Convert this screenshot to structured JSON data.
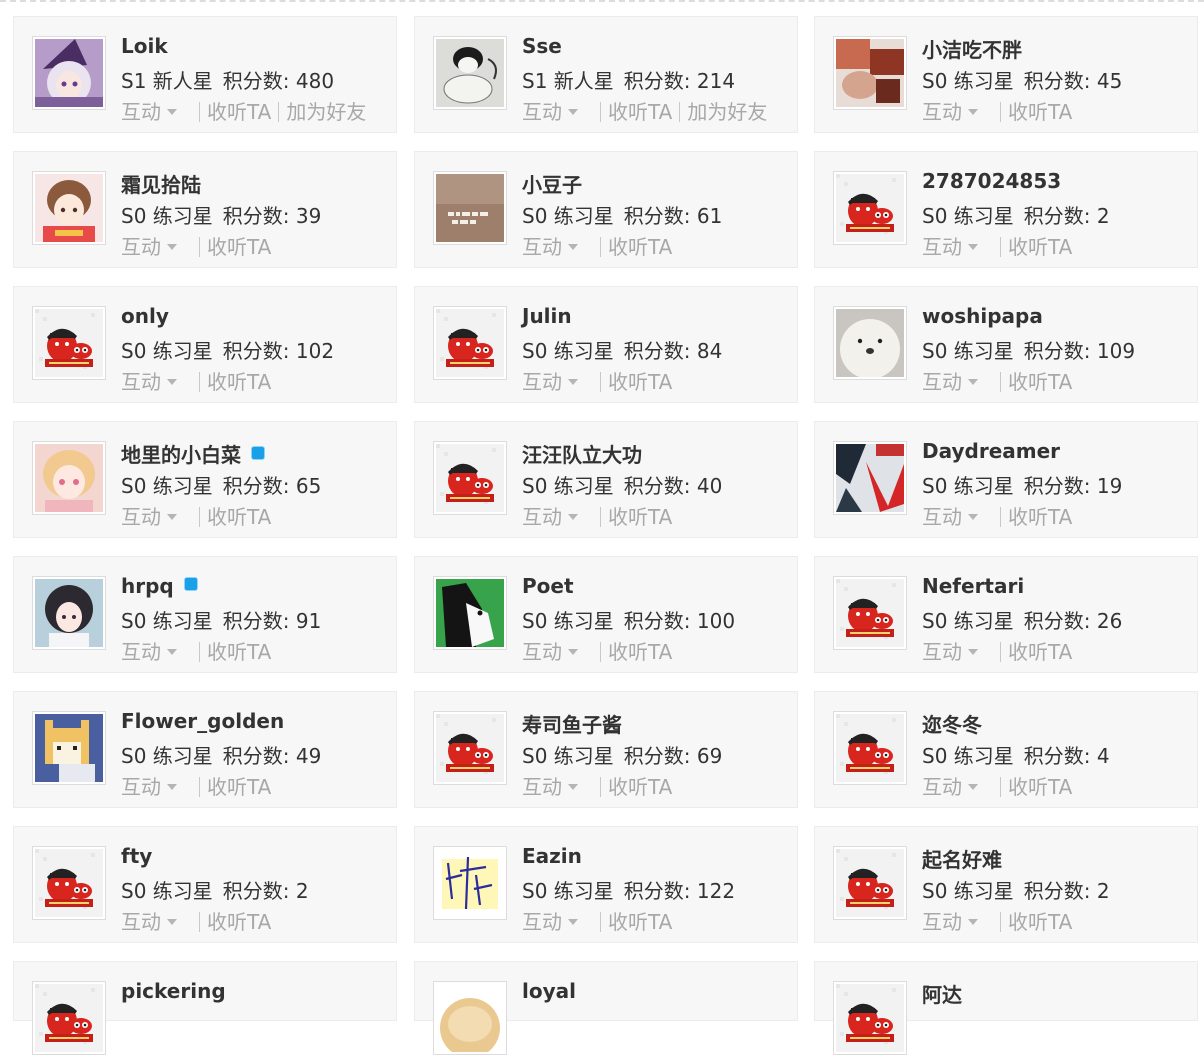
{
  "labels": {
    "interact": "互动",
    "follow": "收听TA",
    "add_friend": "加为好友",
    "score_prefix": "积分数: "
  },
  "users": [
    {
      "name": "Loik",
      "level": "S1 新人星",
      "score": "480",
      "avatar": "anime-witch",
      "badge": false,
      "add_friend": true
    },
    {
      "name": "Sse",
      "level": "S1 新人星",
      "score": "214",
      "avatar": "sketch-cat",
      "badge": false,
      "add_friend": true
    },
    {
      "name": "小洁吃不胖",
      "level": "S0 练习星",
      "score": "45",
      "avatar": "photo-warm",
      "badge": false,
      "add_friend": false
    },
    {
      "name": "霜见拾陆",
      "level": "S0 练习星",
      "score": "39",
      "avatar": "anime-girl",
      "badge": false,
      "add_friend": false
    },
    {
      "name": "小豆子",
      "level": "S0 练习星",
      "score": "61",
      "avatar": "brown-text",
      "badge": false,
      "add_friend": false
    },
    {
      "name": "2787024853",
      "level": "S0 练习星",
      "score": "2",
      "avatar": "default-mascot",
      "badge": false,
      "add_friend": false
    },
    {
      "name": "only",
      "level": "S0 练习星",
      "score": "102",
      "avatar": "default-mascot",
      "badge": false,
      "add_friend": false
    },
    {
      "name": "Julin",
      "level": "S0 练习星",
      "score": "84",
      "avatar": "default-mascot",
      "badge": false,
      "add_friend": false
    },
    {
      "name": "woshipapa",
      "level": "S0 练习星",
      "score": "109",
      "avatar": "white-dog",
      "badge": false,
      "add_friend": false
    },
    {
      "name": "地里的小白菜",
      "level": "S0 练习星",
      "score": "65",
      "avatar": "anime-pink",
      "badge": true,
      "add_friend": false
    },
    {
      "name": "汪汪队立大功",
      "level": "S0 练习星",
      "score": "40",
      "avatar": "default-mascot",
      "badge": false,
      "add_friend": false
    },
    {
      "name": "Daydreamer",
      "level": "S0 练习星",
      "score": "19",
      "avatar": "red-collage",
      "badge": false,
      "add_friend": false
    },
    {
      "name": "hrpq",
      "level": "S0 练习星",
      "score": "91",
      "avatar": "anime-dark",
      "badge": true,
      "add_friend": false
    },
    {
      "name": "Poet",
      "level": "S0 练习星",
      "score": "100",
      "avatar": "green-dog",
      "badge": false,
      "add_friend": false
    },
    {
      "name": "Nefertari",
      "level": "S0 练习星",
      "score": "26",
      "avatar": "default-mascot",
      "badge": false,
      "add_friend": false
    },
    {
      "name": "Flower_golden",
      "level": "S0 练习星",
      "score": "49",
      "avatar": "pixel-shiba",
      "badge": false,
      "add_friend": false
    },
    {
      "name": "寿司鱼子酱",
      "level": "S0 练习星",
      "score": "69",
      "avatar": "default-mascot",
      "badge": false,
      "add_friend": false
    },
    {
      "name": "迩冬冬",
      "level": "S0 练习星",
      "score": "4",
      "avatar": "default-mascot",
      "badge": false,
      "add_friend": false
    },
    {
      "name": "fty",
      "level": "S0 练习星",
      "score": "2",
      "avatar": "default-mascot",
      "badge": false,
      "add_friend": false
    },
    {
      "name": "Eazin",
      "level": "S0 练习星",
      "score": "122",
      "avatar": "blue-scribble",
      "badge": false,
      "add_friend": false
    },
    {
      "name": "起名好难",
      "level": "S0 练习星",
      "score": "2",
      "avatar": "default-mascot",
      "badge": false,
      "add_friend": false
    },
    {
      "name": "pickering",
      "level": "",
      "score": "",
      "avatar": "default-mascot",
      "badge": false,
      "add_friend": false
    },
    {
      "name": "loyal",
      "level": "",
      "score": "",
      "avatar": "blonde-hair",
      "badge": false,
      "add_friend": false
    },
    {
      "name": "阿达",
      "level": "",
      "score": "",
      "avatar": "default-mascot",
      "badge": false,
      "add_friend": false
    }
  ]
}
